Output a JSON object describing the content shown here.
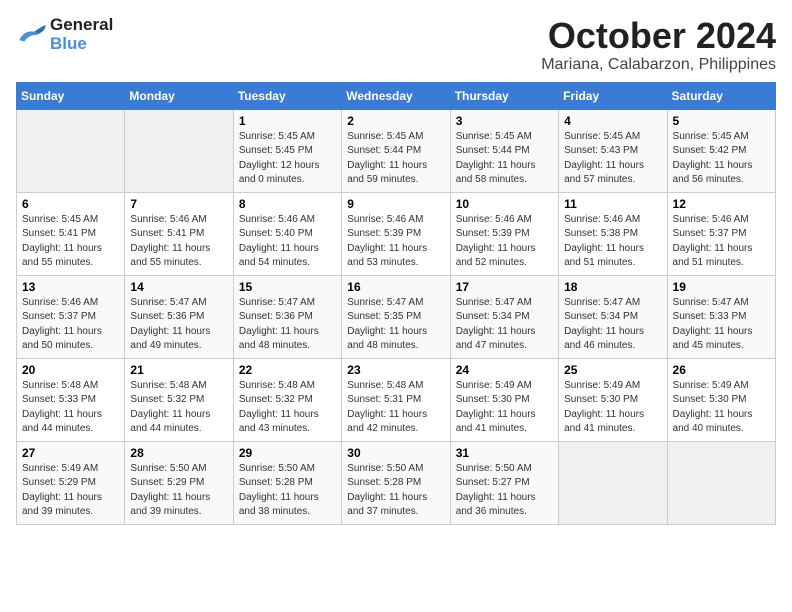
{
  "logo": {
    "line1": "General",
    "line2": "Blue"
  },
  "title": "October 2024",
  "subtitle": "Mariana, Calabarzon, Philippines",
  "headers": [
    "Sunday",
    "Monday",
    "Tuesday",
    "Wednesday",
    "Thursday",
    "Friday",
    "Saturday"
  ],
  "weeks": [
    [
      {
        "day": "",
        "empty": true
      },
      {
        "day": "",
        "empty": true
      },
      {
        "day": "1",
        "sunrise": "Sunrise: 5:45 AM",
        "sunset": "Sunset: 5:45 PM",
        "daylight": "Daylight: 12 hours and 0 minutes."
      },
      {
        "day": "2",
        "sunrise": "Sunrise: 5:45 AM",
        "sunset": "Sunset: 5:44 PM",
        "daylight": "Daylight: 11 hours and 59 minutes."
      },
      {
        "day": "3",
        "sunrise": "Sunrise: 5:45 AM",
        "sunset": "Sunset: 5:44 PM",
        "daylight": "Daylight: 11 hours and 58 minutes."
      },
      {
        "day": "4",
        "sunrise": "Sunrise: 5:45 AM",
        "sunset": "Sunset: 5:43 PM",
        "daylight": "Daylight: 11 hours and 57 minutes."
      },
      {
        "day": "5",
        "sunrise": "Sunrise: 5:45 AM",
        "sunset": "Sunset: 5:42 PM",
        "daylight": "Daylight: 11 hours and 56 minutes."
      }
    ],
    [
      {
        "day": "6",
        "sunrise": "Sunrise: 5:45 AM",
        "sunset": "Sunset: 5:41 PM",
        "daylight": "Daylight: 11 hours and 55 minutes."
      },
      {
        "day": "7",
        "sunrise": "Sunrise: 5:46 AM",
        "sunset": "Sunset: 5:41 PM",
        "daylight": "Daylight: 11 hours and 55 minutes."
      },
      {
        "day": "8",
        "sunrise": "Sunrise: 5:46 AM",
        "sunset": "Sunset: 5:40 PM",
        "daylight": "Daylight: 11 hours and 54 minutes."
      },
      {
        "day": "9",
        "sunrise": "Sunrise: 5:46 AM",
        "sunset": "Sunset: 5:39 PM",
        "daylight": "Daylight: 11 hours and 53 minutes."
      },
      {
        "day": "10",
        "sunrise": "Sunrise: 5:46 AM",
        "sunset": "Sunset: 5:39 PM",
        "daylight": "Daylight: 11 hours and 52 minutes."
      },
      {
        "day": "11",
        "sunrise": "Sunrise: 5:46 AM",
        "sunset": "Sunset: 5:38 PM",
        "daylight": "Daylight: 11 hours and 51 minutes."
      },
      {
        "day": "12",
        "sunrise": "Sunrise: 5:46 AM",
        "sunset": "Sunset: 5:37 PM",
        "daylight": "Daylight: 11 hours and 51 minutes."
      }
    ],
    [
      {
        "day": "13",
        "sunrise": "Sunrise: 5:46 AM",
        "sunset": "Sunset: 5:37 PM",
        "daylight": "Daylight: 11 hours and 50 minutes."
      },
      {
        "day": "14",
        "sunrise": "Sunrise: 5:47 AM",
        "sunset": "Sunset: 5:36 PM",
        "daylight": "Daylight: 11 hours and 49 minutes."
      },
      {
        "day": "15",
        "sunrise": "Sunrise: 5:47 AM",
        "sunset": "Sunset: 5:36 PM",
        "daylight": "Daylight: 11 hours and 48 minutes."
      },
      {
        "day": "16",
        "sunrise": "Sunrise: 5:47 AM",
        "sunset": "Sunset: 5:35 PM",
        "daylight": "Daylight: 11 hours and 48 minutes."
      },
      {
        "day": "17",
        "sunrise": "Sunrise: 5:47 AM",
        "sunset": "Sunset: 5:34 PM",
        "daylight": "Daylight: 11 hours and 47 minutes."
      },
      {
        "day": "18",
        "sunrise": "Sunrise: 5:47 AM",
        "sunset": "Sunset: 5:34 PM",
        "daylight": "Daylight: 11 hours and 46 minutes."
      },
      {
        "day": "19",
        "sunrise": "Sunrise: 5:47 AM",
        "sunset": "Sunset: 5:33 PM",
        "daylight": "Daylight: 11 hours and 45 minutes."
      }
    ],
    [
      {
        "day": "20",
        "sunrise": "Sunrise: 5:48 AM",
        "sunset": "Sunset: 5:33 PM",
        "daylight": "Daylight: 11 hours and 44 minutes."
      },
      {
        "day": "21",
        "sunrise": "Sunrise: 5:48 AM",
        "sunset": "Sunset: 5:32 PM",
        "daylight": "Daylight: 11 hours and 44 minutes."
      },
      {
        "day": "22",
        "sunrise": "Sunrise: 5:48 AM",
        "sunset": "Sunset: 5:32 PM",
        "daylight": "Daylight: 11 hours and 43 minutes."
      },
      {
        "day": "23",
        "sunrise": "Sunrise: 5:48 AM",
        "sunset": "Sunset: 5:31 PM",
        "daylight": "Daylight: 11 hours and 42 minutes."
      },
      {
        "day": "24",
        "sunrise": "Sunrise: 5:49 AM",
        "sunset": "Sunset: 5:30 PM",
        "daylight": "Daylight: 11 hours and 41 minutes."
      },
      {
        "day": "25",
        "sunrise": "Sunrise: 5:49 AM",
        "sunset": "Sunset: 5:30 PM",
        "daylight": "Daylight: 11 hours and 41 minutes."
      },
      {
        "day": "26",
        "sunrise": "Sunrise: 5:49 AM",
        "sunset": "Sunset: 5:30 PM",
        "daylight": "Daylight: 11 hours and 40 minutes."
      }
    ],
    [
      {
        "day": "27",
        "sunrise": "Sunrise: 5:49 AM",
        "sunset": "Sunset: 5:29 PM",
        "daylight": "Daylight: 11 hours and 39 minutes."
      },
      {
        "day": "28",
        "sunrise": "Sunrise: 5:50 AM",
        "sunset": "Sunset: 5:29 PM",
        "daylight": "Daylight: 11 hours and 39 minutes."
      },
      {
        "day": "29",
        "sunrise": "Sunrise: 5:50 AM",
        "sunset": "Sunset: 5:28 PM",
        "daylight": "Daylight: 11 hours and 38 minutes."
      },
      {
        "day": "30",
        "sunrise": "Sunrise: 5:50 AM",
        "sunset": "Sunset: 5:28 PM",
        "daylight": "Daylight: 11 hours and 37 minutes."
      },
      {
        "day": "31",
        "sunrise": "Sunrise: 5:50 AM",
        "sunset": "Sunset: 5:27 PM",
        "daylight": "Daylight: 11 hours and 36 minutes."
      },
      {
        "day": "",
        "empty": true
      },
      {
        "day": "",
        "empty": true
      }
    ]
  ]
}
